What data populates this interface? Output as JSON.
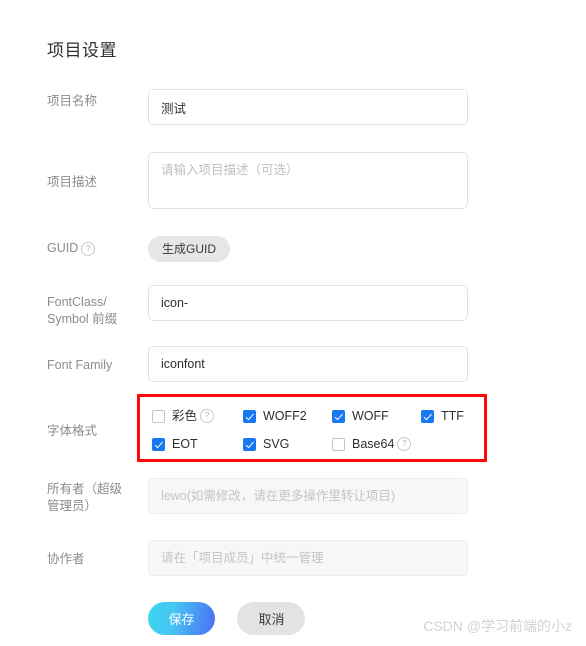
{
  "page": {
    "title": "项目设置",
    "watermark": "CSDN @学习前端的小z",
    "accent_color": "#1778f2",
    "annotation_color": "#fb0b0b"
  },
  "fields": {
    "project_name": {
      "label": "项目名称",
      "value": "测试",
      "placeholder": ""
    },
    "project_desc": {
      "label": "项目描述",
      "value": "",
      "placeholder": "请输入项目描述（可选）"
    },
    "guid": {
      "label": "GUID",
      "help_icon": "question-circle-icon",
      "button_label": "生成GUID"
    },
    "font_class_prefix": {
      "label_line1": "FontClass/",
      "label_line2": "Symbol 前缀",
      "value": "icon-",
      "placeholder": ""
    },
    "font_family": {
      "label": "Font Family",
      "value": "iconfont",
      "placeholder": ""
    },
    "font_format": {
      "label": "字体格式",
      "options": [
        {
          "name": "彩色",
          "checked": false,
          "help_icon": "question-circle-icon"
        },
        {
          "name": "WOFF2",
          "checked": true,
          "help_icon": ""
        },
        {
          "name": "WOFF",
          "checked": true,
          "help_icon": ""
        },
        {
          "name": "TTF",
          "checked": true,
          "help_icon": ""
        },
        {
          "name": "EOT",
          "checked": true,
          "help_icon": ""
        },
        {
          "name": "SVG",
          "checked": true,
          "help_icon": ""
        },
        {
          "name": "Base64",
          "checked": false,
          "help_icon": "question-circle-icon"
        }
      ]
    },
    "owner": {
      "label_line1": "所有者（超级",
      "label_line2": "管理员）",
      "value": "",
      "placeholder": "lewo(如需修改，请在更多操作里转让项目)"
    },
    "collaborator": {
      "label": "协作者",
      "value": "",
      "placeholder": "请在「项目成员」中统一管理"
    }
  },
  "actions": {
    "save_label": "保存",
    "cancel_label": "取消"
  }
}
